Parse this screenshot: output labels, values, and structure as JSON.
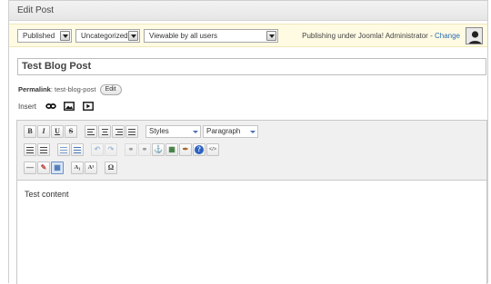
{
  "panel": {
    "title": "Edit Post"
  },
  "publish": {
    "status": "Published",
    "category": "Uncategorized",
    "visibility": "Viewable by all users",
    "publishing_under": "Publishing under Joomla! Administrator - ",
    "change_link": "Change"
  },
  "post": {
    "title": "Test Blog Post",
    "permalink_label": "Permalink",
    "permalink_value": ": test-blog-post",
    "edit_label": "Edit",
    "content": "Test content"
  },
  "insert": {
    "label": "Insert"
  },
  "toolbar": {
    "bold": "B",
    "italic": "I",
    "underline": "U",
    "strike": "S",
    "styles_select": "Styles",
    "format_select": "Paragraph",
    "subscript": "A₁",
    "superscript": "A¹",
    "omega": "Ω"
  },
  "icons": {
    "insert": [
      "link-icon",
      "image-icon",
      "video-icon"
    ],
    "toolbar": [
      "bold-icon",
      "italic-icon",
      "underline-icon",
      "strikethrough-icon",
      "align-left-icon",
      "align-center-icon",
      "align-right-icon",
      "align-justify-icon",
      "bullet-list-icon",
      "numbered-list-icon",
      "outdent-icon",
      "indent-icon",
      "undo-icon",
      "redo-icon",
      "link-icon",
      "unlink-icon",
      "anchor-icon",
      "image-icon",
      "cleanup-icon",
      "help-icon",
      "html-icon",
      "horizontal-rule-icon",
      "remove-format-icon",
      "visual-aid-icon",
      "subscript-icon",
      "superscript-icon",
      "special-char-icon"
    ]
  }
}
